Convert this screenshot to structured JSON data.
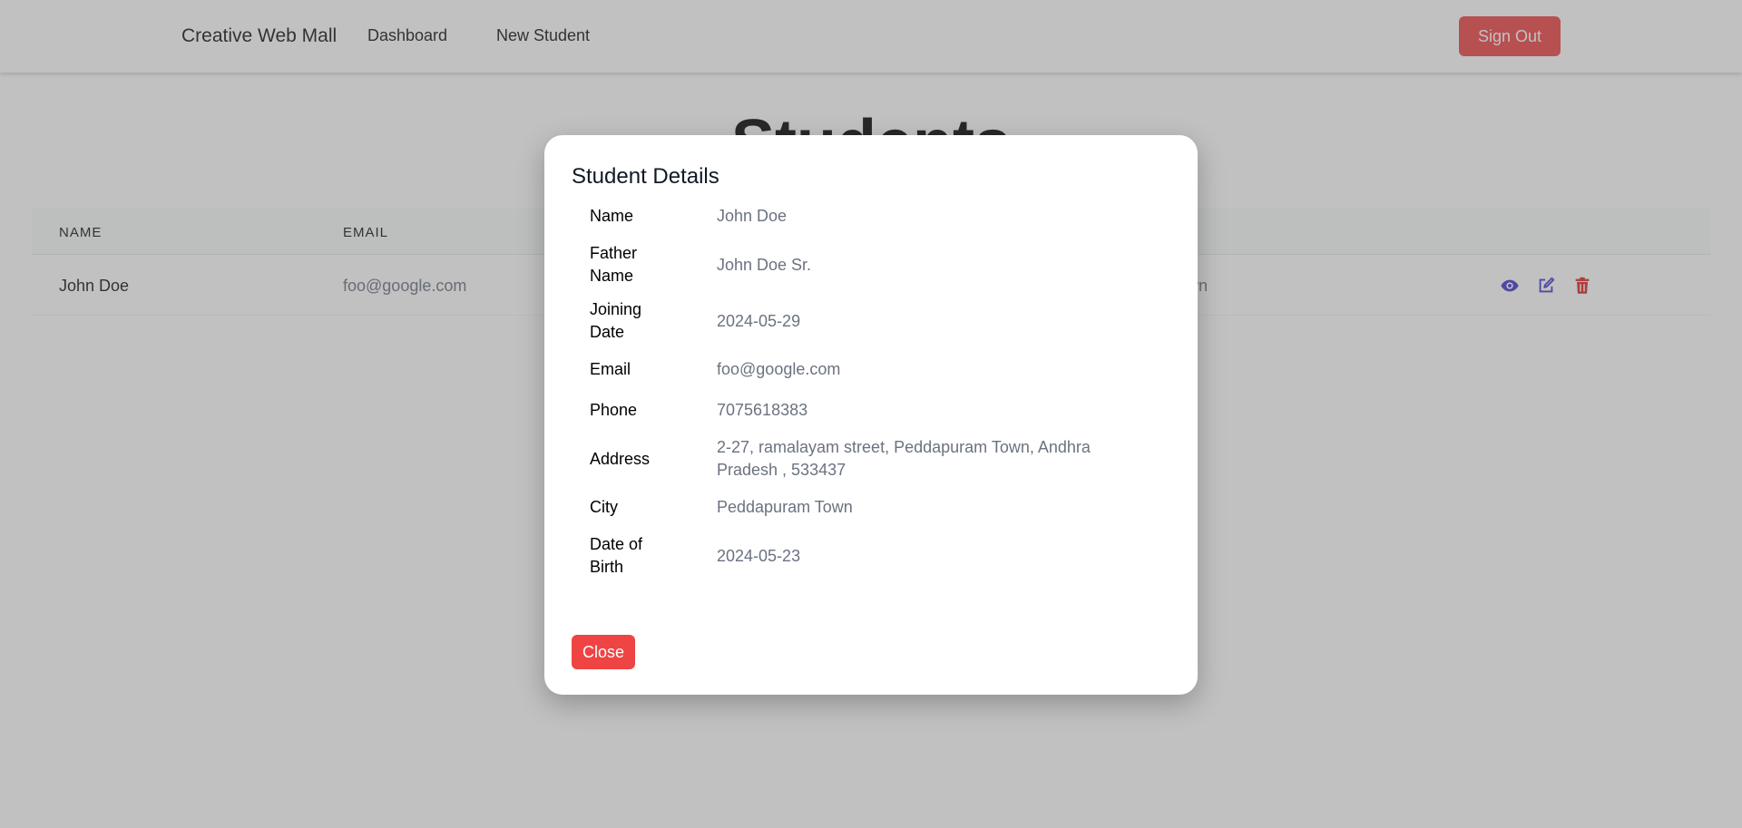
{
  "navbar": {
    "brand": "Creative Web Mall",
    "links": [
      "Dashboard",
      "New Student"
    ],
    "sign_out": "Sign Out"
  },
  "page": {
    "title": "Students"
  },
  "table": {
    "headers": [
      "NAME",
      "EMAIL"
    ],
    "rows": [
      {
        "name": "John Doe",
        "email": "foo@google.com",
        "city_fragment": "own"
      }
    ],
    "actions": [
      "eye-icon",
      "edit-icon",
      "trash-icon"
    ]
  },
  "modal": {
    "title": "Student Details",
    "fields": [
      {
        "label": "Name",
        "value": "John Doe"
      },
      {
        "label": "Father Name",
        "value": "John Doe Sr."
      },
      {
        "label": "Joining Date",
        "value": "2024-05-29"
      },
      {
        "label": "Email",
        "value": "foo@google.com"
      },
      {
        "label": "Phone",
        "value": "7075618383"
      },
      {
        "label": "Address",
        "value": "2-27, ramalayam street, Peddapuram Town, Andhra Pradesh , 533437"
      },
      {
        "label": "City",
        "value": "Peddapuram Town"
      },
      {
        "label": "Date of Birth",
        "value": "2024-05-23"
      }
    ],
    "close_label": "Close"
  },
  "colors": {
    "danger": "#ef4444",
    "action_blue": "#4338ca",
    "muted_text": "#6b7280"
  }
}
